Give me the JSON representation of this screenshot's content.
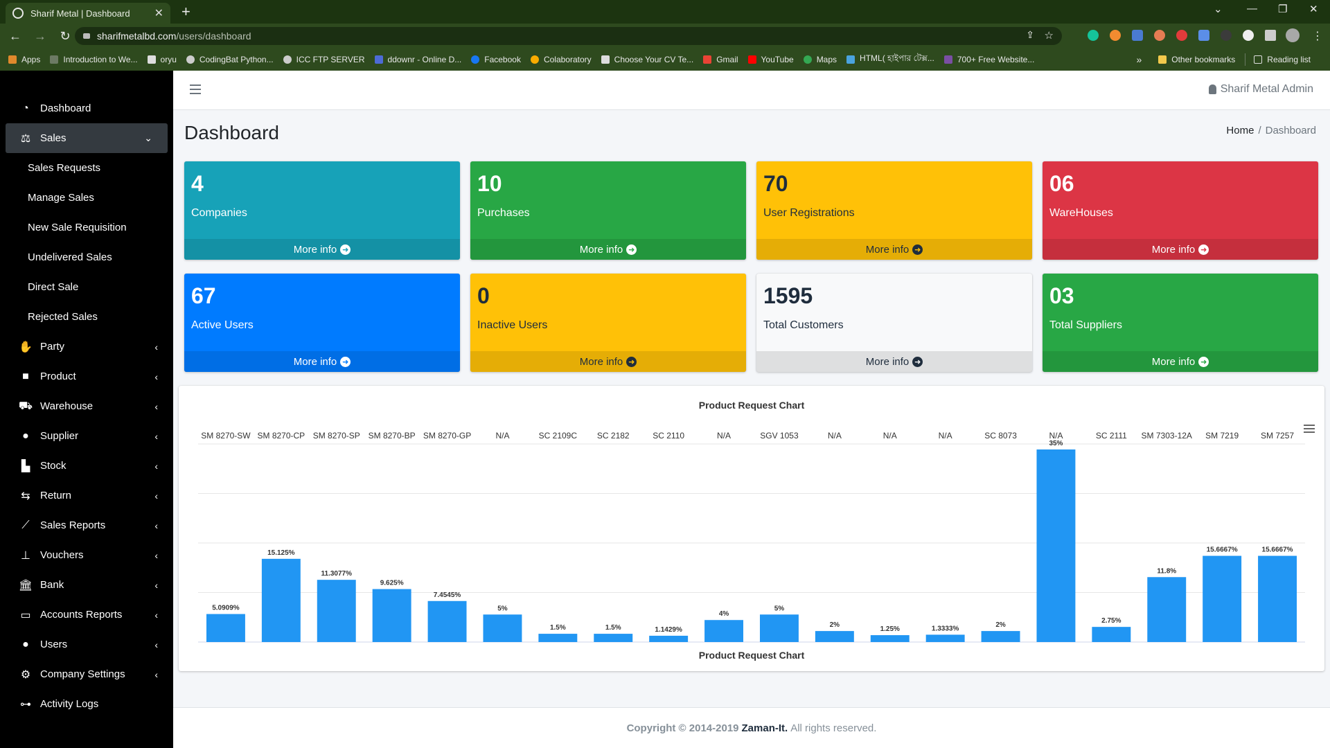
{
  "browser": {
    "tab_title": "Sharif Metal | Dashboard",
    "url_host": "sharifmetalbd.com",
    "url_path": "/users/dashboard",
    "bookmarks": [
      "Apps",
      "Introduction to We...",
      "oryu",
      "CodingBat Python...",
      "ICC FTP SERVER",
      "ddownr - Online D...",
      "Facebook",
      "Colaboratory",
      "Choose Your CV Te...",
      "Gmail",
      "YouTube",
      "Maps",
      "HTML( হাইপার টেক্স...",
      "700+ Free Website..."
    ],
    "bookmarks_overflow": "»",
    "other_bookmarks": "Other bookmarks",
    "reading_list": "Reading list"
  },
  "topnav": {
    "admin_name": "Sharif Metal Admin"
  },
  "page": {
    "title": "Dashboard",
    "breadcrumb_home": "Home",
    "breadcrumb_sep": "/",
    "breadcrumb_current": "Dashboard"
  },
  "sidebar": {
    "items": [
      {
        "label": "Dashboard",
        "icon": "tachometer-icon"
      },
      {
        "label": "Sales",
        "icon": "balance-scale-icon"
      },
      {
        "label": "Party",
        "icon": "handshake-icon"
      },
      {
        "label": "Product",
        "icon": "shopping-bag-icon"
      },
      {
        "label": "Warehouse",
        "icon": "shopping-cart-icon"
      },
      {
        "label": "Supplier",
        "icon": "user-icon"
      },
      {
        "label": "Stock",
        "icon": "bar-chart-icon"
      },
      {
        "label": "Return",
        "icon": "exchange-icon"
      },
      {
        "label": "Sales Reports",
        "icon": "line-chart-icon"
      },
      {
        "label": "Vouchers",
        "icon": "sitemap-icon"
      },
      {
        "label": "Bank",
        "icon": "bank-icon"
      },
      {
        "label": "Accounts Reports",
        "icon": "credit-card-icon"
      },
      {
        "label": "Users",
        "icon": "user-icon"
      },
      {
        "label": "Company Settings",
        "icon": "cog-icon"
      },
      {
        "label": "Activity Logs",
        "icon": "project-diagram-icon"
      }
    ],
    "sales_subitems": [
      "Sales Requests",
      "Manage Sales",
      "New Sale Requisition",
      "Undelivered Sales",
      "Direct Sale",
      "Rejected Sales"
    ]
  },
  "stats": [
    {
      "value": "4",
      "label": "Companies",
      "more": "More info",
      "color": "#17a2b8"
    },
    {
      "value": "10",
      "label": "Purchases",
      "more": "More info",
      "color": "#28a745"
    },
    {
      "value": "70",
      "label": "User Registrations",
      "more": "More info",
      "color": "#ffc107"
    },
    {
      "value": "06",
      "label": "WareHouses",
      "more": "More info",
      "color": "#dc3545"
    },
    {
      "value": "67",
      "label": "Active Users",
      "more": "More info",
      "color": "#007bff"
    },
    {
      "value": "0",
      "label": "Inactive Users",
      "more": "More info",
      "color": "#ffc107"
    },
    {
      "value": "1595",
      "label": "Total Customers",
      "more": "More info",
      "color": "#f8f9fa"
    },
    {
      "value": "03",
      "label": "Total Suppliers",
      "more": "More info",
      "color": "#28a745"
    }
  ],
  "chart_data": {
    "type": "bar",
    "title": "Product Request Chart",
    "xlabel": "Product Request Chart",
    "ylabel": "",
    "categories": [
      "SM 8270-SW",
      "SM 8270-CP",
      "SM 8270-SP",
      "SM 8270-BP",
      "SM 8270-GP",
      "N/A",
      "SC 2109C",
      "SC 2182",
      "SC 2110",
      "N/A",
      "SGV 1053",
      "N/A",
      "N/A",
      "N/A",
      "SC 8073",
      "N/A",
      "SC 2111",
      "SM 7303-12A",
      "SM 7219",
      "SM 7257"
    ],
    "values": [
      5.0909,
      15.125,
      11.3077,
      9.625,
      7.4545,
      5,
      1.5,
      1.5,
      1.1429,
      4,
      5,
      2,
      1.25,
      1.3333,
      2,
      35,
      2.75,
      11.8,
      15.6667,
      15.6667
    ],
    "value_labels": [
      "5.0909%",
      "15.125%",
      "11.3077%",
      "9.625%",
      "7.4545%",
      "5%",
      "1.5%",
      "1.5%",
      "1.1429%",
      "4%",
      "5%",
      "2%",
      "1.25%",
      "1.3333%",
      "2%",
      "35%",
      "2.75%",
      "11.8%",
      "15.6667%",
      "15.6667%"
    ],
    "ylim": [
      0,
      36
    ],
    "grid": true,
    "legend": "none",
    "bar_color": "#2196f3"
  },
  "footer": {
    "prefix": "Copyright © 2014-2019",
    "brand": "Zaman-It.",
    "suffix": "All rights reserved."
  }
}
